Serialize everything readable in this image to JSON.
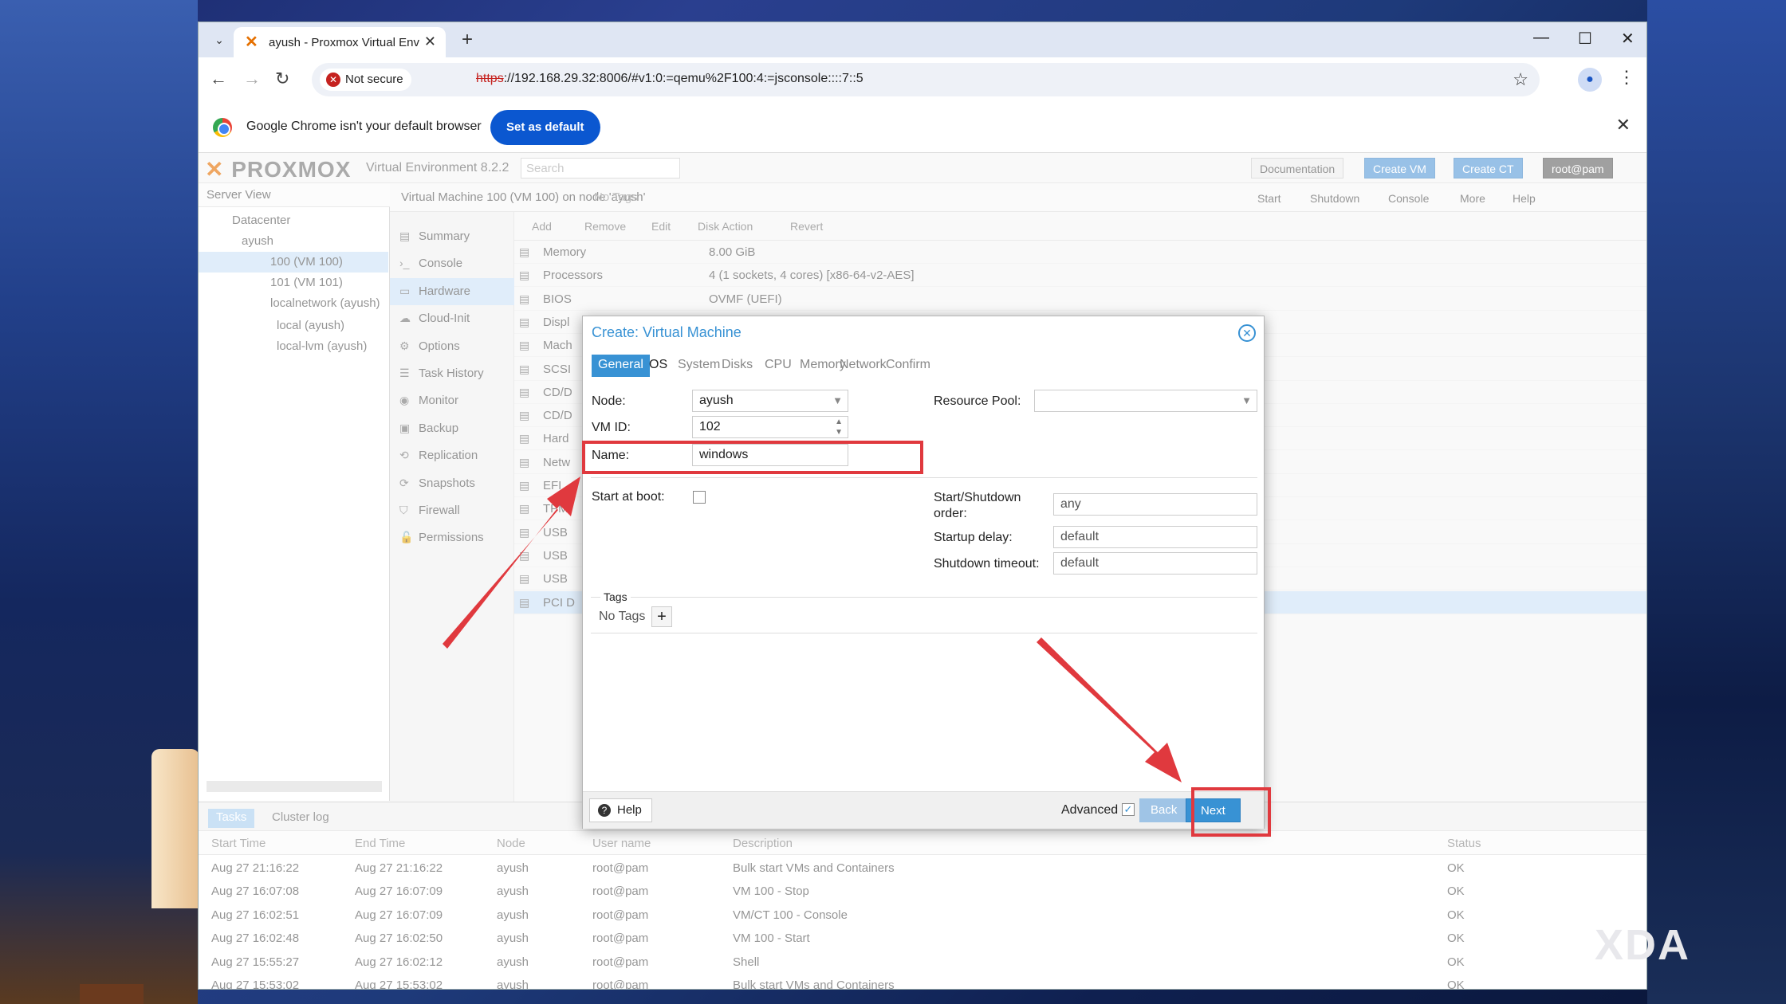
{
  "browser": {
    "tab_title": "ayush - Proxmox Virtual Environ",
    "new_tab": "+",
    "window_controls": {
      "minimize": "—",
      "maximize": "☐",
      "close": "✕"
    },
    "not_secure": "Not secure",
    "url_scheme": "https",
    "url_rest": "://192.168.29.32:8006/#v1:0:=qemu%2F100:4:=jsconsole::::7::5",
    "infobar_text": "Google Chrome isn't your default browser",
    "set_default": "Set as default"
  },
  "pve": {
    "logo": "PROXMOX",
    "version": "Virtual Environment 8.2.2",
    "search_placeholder": "Search",
    "header_buttons": [
      "Documentation",
      "Create VM",
      "Create CT",
      "root@pam"
    ],
    "server_view": "Server View",
    "tree": [
      "Datacenter",
      "ayush",
      "100 (VM 100)",
      "101 (VM 101)",
      "localnetwork (ayush)",
      "local (ayush)",
      "local-lvm (ayush)"
    ],
    "vm_title": "Virtual Machine 100 (VM 100) on node 'ayush'",
    "no_tags": "No Tags",
    "vm_buttons": [
      "Start",
      "Shutdown",
      "Console",
      "More",
      "Help"
    ],
    "side_menu": [
      "Summary",
      "Console",
      "Hardware",
      "Cloud-Init",
      "Options",
      "Task History",
      "Monitor",
      "Backup",
      "Replication",
      "Snapshots",
      "Firewall",
      "Permissions"
    ],
    "hw_toolbar": [
      "Add",
      "Remove",
      "Edit",
      "Disk Action",
      "Revert"
    ],
    "hw_rows": [
      {
        "k": "Memory",
        "v": "8.00 GiB"
      },
      {
        "k": "Processors",
        "v": "4 (1 sockets, 4 cores) [x86-64-v2-AES]"
      },
      {
        "k": "BIOS",
        "v": "OVMF (UEFI)"
      },
      {
        "k": "Displ",
        "v": ""
      },
      {
        "k": "Mach",
        "v": ""
      },
      {
        "k": "SCSI",
        "v": ""
      },
      {
        "k": "CD/D",
        "v": ""
      },
      {
        "k": "CD/D",
        "v": ""
      },
      {
        "k": "Hard",
        "v": ""
      },
      {
        "k": "Netw",
        "v": ""
      },
      {
        "k": "EFI",
        "v": ""
      },
      {
        "k": "TPM",
        "v": ""
      },
      {
        "k": "USB",
        "v": ""
      },
      {
        "k": "USB",
        "v": ""
      },
      {
        "k": "USB",
        "v": ""
      },
      {
        "k": "PCI D",
        "v": ""
      }
    ],
    "task_tabs": [
      "Tasks",
      "Cluster log"
    ],
    "task_headers": [
      "Start Time",
      "End Time",
      "Node",
      "User name",
      "Description",
      "Status"
    ],
    "tasks": [
      [
        "Aug 27 21:16:22",
        "Aug 27 21:16:22",
        "ayush",
        "root@pam",
        "Bulk start VMs and Containers",
        "OK"
      ],
      [
        "Aug 27 16:07:08",
        "Aug 27 16:07:09",
        "ayush",
        "root@pam",
        "VM 100 - Stop",
        "OK"
      ],
      [
        "Aug 27 16:02:51",
        "Aug 27 16:07:09",
        "ayush",
        "root@pam",
        "VM/CT 100 - Console",
        "OK"
      ],
      [
        "Aug 27 16:02:48",
        "Aug 27 16:02:50",
        "ayush",
        "root@pam",
        "VM 100 - Start",
        "OK"
      ],
      [
        "Aug 27 15:55:27",
        "Aug 27 16:02:12",
        "ayush",
        "root@pam",
        "Shell",
        "OK"
      ],
      [
        "Aug 27 15:53:02",
        "Aug 27 15:53:02",
        "ayush",
        "root@pam",
        "Bulk start VMs and Containers",
        "OK"
      ]
    ]
  },
  "dialog": {
    "title": "Create: Virtual Machine",
    "tabs": [
      "General",
      "OS",
      "System",
      "Disks",
      "CPU",
      "Memory",
      "Network",
      "Confirm"
    ],
    "node_label": "Node:",
    "node_value": "ayush",
    "vmid_label": "VM ID:",
    "vmid_value": "102",
    "name_label": "Name:",
    "name_value": "windows",
    "pool_label": "Resource Pool:",
    "boot_label": "Start at boot:",
    "order_label": "Start/Shutdown order:",
    "order_value": "any",
    "delay_label": "Startup delay:",
    "delay_value": "default",
    "timeout_label": "Shutdown timeout:",
    "timeout_value": "default",
    "tags_legend": "Tags",
    "tags_none": "No Tags",
    "help": "Help",
    "advanced": "Advanced",
    "back": "Back",
    "next": "Next"
  },
  "watermark": "XDA"
}
